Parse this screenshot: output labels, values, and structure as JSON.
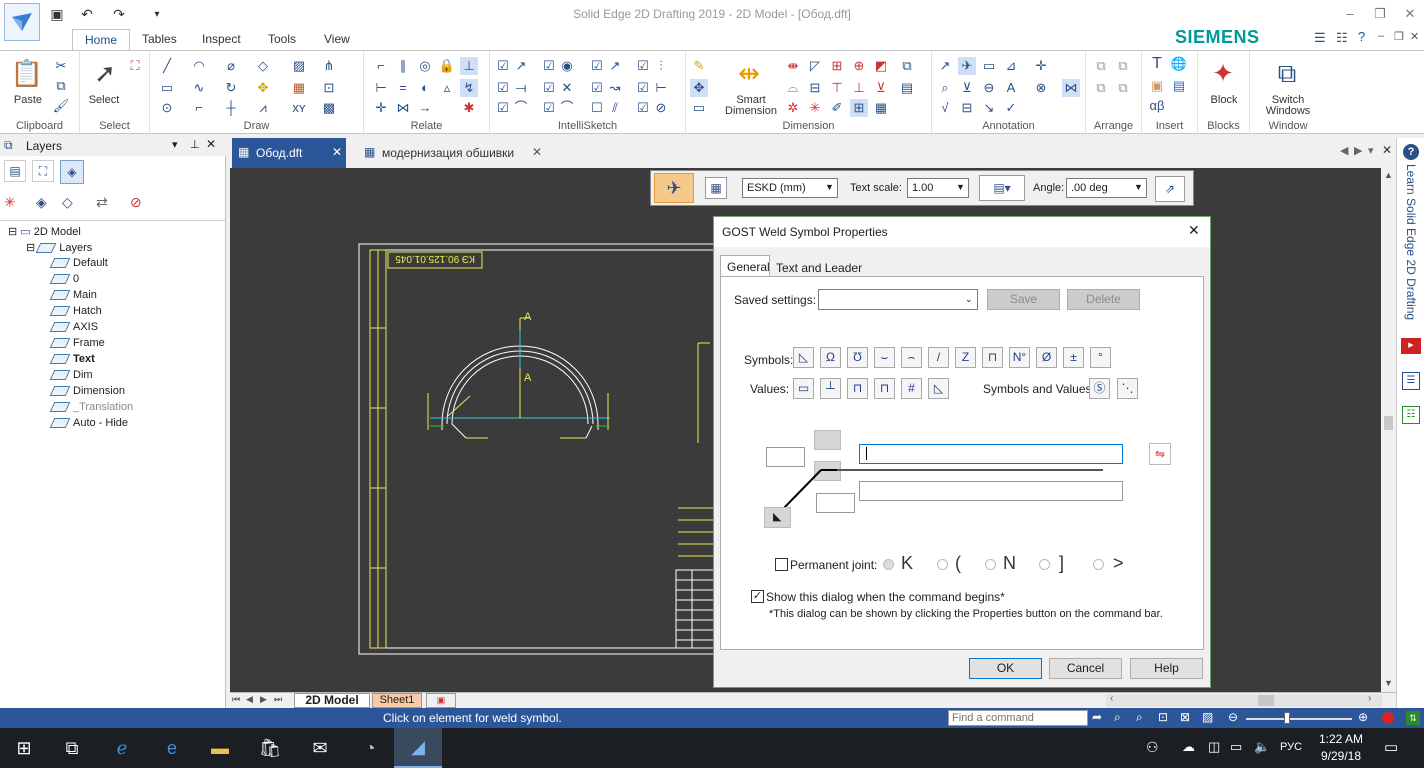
{
  "app": {
    "title": "Solid Edge 2D Drafting 2019 - 2D Model - [Обод.dft]",
    "brand": "SIEMENS",
    "ribbon_tabs": [
      "Home",
      "Tables",
      "Inspect",
      "Tools",
      "View"
    ],
    "groups": {
      "clipboard": "Clipboard",
      "select": "Select",
      "draw": "Draw",
      "relate": "Relate",
      "intellisketch": "IntelliSketch",
      "dimension": "Dimension",
      "annotation": "Annotation",
      "arrange": "Arrange",
      "insert": "Insert",
      "blocks": "Blocks",
      "window": "Window"
    },
    "buttons": {
      "paste": "Paste",
      "select": "Select",
      "smart_dimension_1": "Smart",
      "smart_dimension_2": "Dimension",
      "block": "Block",
      "switch_windows_1": "Switch",
      "switch_windows_2": "Windows"
    }
  },
  "layers_panel": {
    "title": "Layers",
    "root": "2D Model",
    "group": "Layers",
    "items": [
      {
        "label": "Default",
        "style": "normal"
      },
      {
        "label": "0",
        "style": "normal"
      },
      {
        "label": "Main",
        "style": "normal"
      },
      {
        "label": "Hatch",
        "style": "normal"
      },
      {
        "label": "AXIS",
        "style": "normal"
      },
      {
        "label": "Frame",
        "style": "normal"
      },
      {
        "label": "Text",
        "style": "bold"
      },
      {
        "label": "Dim",
        "style": "normal"
      },
      {
        "label": "Dimension",
        "style": "normal"
      },
      {
        "label": "_Translation",
        "style": "dim"
      },
      {
        "label": "Auto - Hide",
        "style": "normal"
      }
    ]
  },
  "document_tabs": [
    {
      "label": "Обод.dft",
      "active": true
    },
    {
      "label": "модернизация обшивки",
      "active": false
    }
  ],
  "command_bar": {
    "standard": "ESKD (mm)",
    "text_scale_label": "Text scale:",
    "text_scale_value": "1.00",
    "angle_label": "Angle:",
    "angle_value": ".00 deg"
  },
  "dialog": {
    "title": "GOST Weld Symbol Properties",
    "tabs": [
      "General",
      "Text and Leader"
    ],
    "saved_settings_label": "Saved settings:",
    "save": "Save",
    "delete": "Delete",
    "symbols_label": "Symbols:",
    "values_label": "Values:",
    "symbols_and_values_label": "Symbols and Values:",
    "permanent_joint_label": "Permanent joint:",
    "show_dialog_label": "Show this dialog when the command begins*",
    "show_dialog_checked": true,
    "footnote": "*This dialog can be shown by clicking the Properties button on the command bar.",
    "ok": "OK",
    "cancel": "Cancel",
    "help": "Help",
    "symbol_glyphs": [
      "◺",
      "Ω",
      "Ʊ",
      "⌣",
      "⌢",
      "/",
      "Z",
      "⊓",
      "N°",
      "Ø",
      "±",
      "°"
    ],
    "joint_glyphs": [
      "K",
      "(",
      "N",
      "]",
      ">"
    ]
  },
  "drawing": {
    "stamp_text": "КЭ 90.125.01.045",
    "section_label": "A"
  },
  "sheet_tabs": [
    "2D Model",
    "Sheet1"
  ],
  "status": {
    "prompt": "Click on element for weld symbol.",
    "find_placeholder": "Find a command"
  },
  "side_help": "Learn Solid Edge 2D Drafting",
  "taskbar": {
    "language": "РУС",
    "time": "1:22 AM",
    "date": "9/29/18"
  }
}
